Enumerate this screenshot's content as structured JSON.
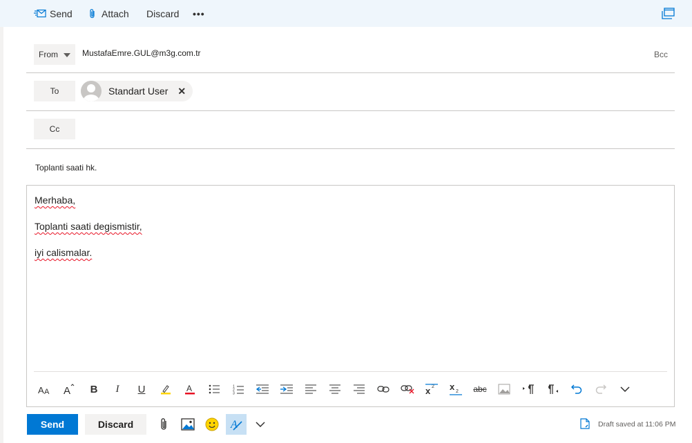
{
  "toolbar": {
    "send_label": "Send",
    "attach_label": "Attach",
    "discard_label": "Discard",
    "more_label": "•••"
  },
  "header": {
    "from_label": "From",
    "from_value": "MustafaEmre.GUL@m3g.com.tr",
    "bcc_label": "Bcc",
    "to_label": "To",
    "to_recipient": "Standart User",
    "remove_glyph": "✕",
    "cc_label": "Cc",
    "subject": "Toplanti saati hk."
  },
  "body": {
    "lines": [
      "Merhaba,",
      "Toplanti saati degismistir,",
      "iyi calismalar."
    ]
  },
  "format_toolbar": {
    "icons": [
      "font-size-icon",
      "grow-font-icon",
      "bold-icon",
      "italic-icon",
      "underline-icon",
      "highlight-icon",
      "font-color-icon",
      "bullets-icon",
      "numbering-icon",
      "decrease-indent-icon",
      "increase-indent-icon",
      "align-left-icon",
      "align-center-icon",
      "align-right-icon",
      "insert-link-icon",
      "remove-link-icon",
      "superscript-icon",
      "subscript-icon",
      "strikethrough-icon",
      "insert-image-icon",
      "ltr-icon",
      "rtl-icon",
      "undo-icon",
      "redo-icon",
      "more-options-icon"
    ],
    "bold_glyph": "B",
    "italic_glyph": "I",
    "underline_glyph": "U",
    "strike_glyph": "abc"
  },
  "actions": {
    "send_label": "Send",
    "discard_label": "Discard",
    "draft_status": "Draft saved at 11:06 PM"
  },
  "colors": {
    "accent": "#0078d4",
    "toolbar_bg": "#eff6fc",
    "button_gray": "#f3f2f1",
    "border": "#c8c6c4",
    "spell_error": "#e81123",
    "font_color_bar": "#e81123",
    "highlight_bar": "#ffd400"
  }
}
